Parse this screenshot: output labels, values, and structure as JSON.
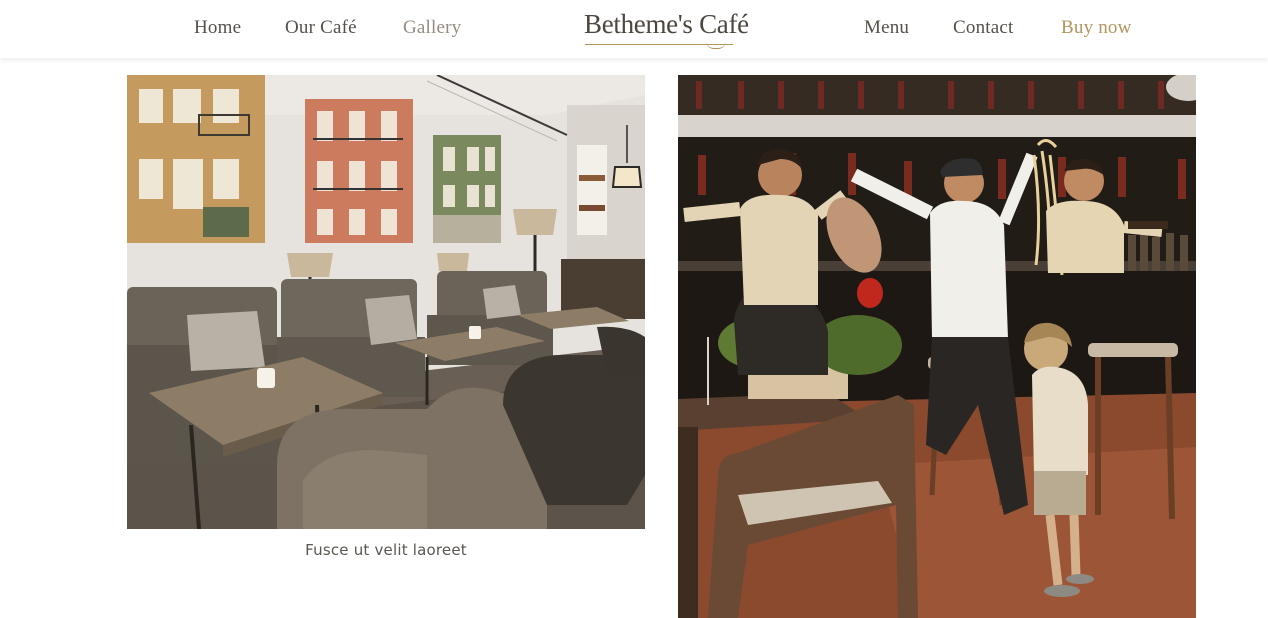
{
  "nav": {
    "left": [
      {
        "label": "Home"
      },
      {
        "label": "Our Café"
      },
      {
        "label": "Gallery"
      }
    ],
    "right": [
      {
        "label": "Menu"
      },
      {
        "label": "Contact"
      },
      {
        "label": "Buy now"
      }
    ]
  },
  "logo": {
    "text": "Betheme's Café"
  },
  "gallery": {
    "items": [
      {
        "caption": "Fusce ut velit laoreet",
        "image": "cafe-lounge-interior-photo"
      },
      {
        "caption": "",
        "image": "staff-with-food-at-bar-photo"
      }
    ]
  },
  "colors": {
    "accent": "#b3955c",
    "nav_text": "#555049",
    "nav_active": "#948c7f",
    "caption_text": "#5a5650"
  }
}
